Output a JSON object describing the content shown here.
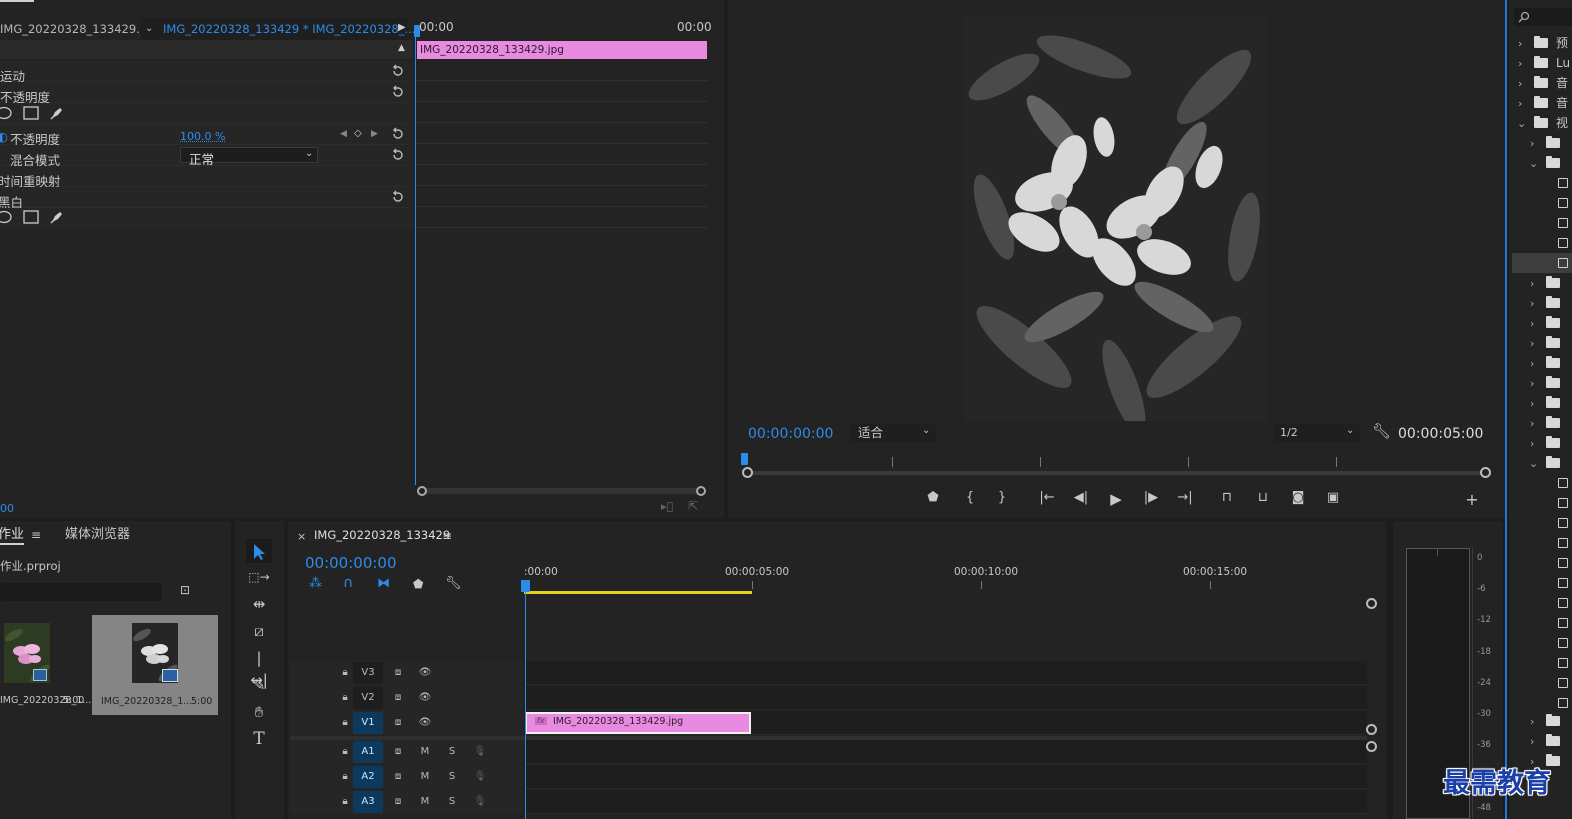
{
  "effect_controls": {
    "master_clip": "IMG_20220328_133429.jpg",
    "sequence_clip": "IMG_20220328_133429 * IMG_20220328_...",
    "time_start": "00:00",
    "time_end": "00:00",
    "clip_bar_label": "IMG_20220328_133429.jpg",
    "rows": {
      "motion": "运动",
      "opacity": "不透明度",
      "opacity_prop": "不透明度",
      "opacity_value": "100.0 %",
      "blend_mode_label": "混合模式",
      "blend_mode_value": "正常",
      "time_remap": "时间重映射",
      "black_white": "黑白"
    },
    "bottom_time": "00"
  },
  "program_monitor": {
    "timecode_left": "00:00:00:00",
    "fit_label": "适合",
    "resolution": "1/2",
    "timecode_right": "00:00:05:00"
  },
  "project": {
    "tab_project": "作业",
    "tab_media_browser": "媒体浏览器",
    "project_file": "作业.prproj",
    "items": [
      {
        "name": "IMG_20220328_1...",
        "duration": "5:00"
      },
      {
        "name": "IMG_20220328_1...",
        "duration": "5:00"
      }
    ]
  },
  "timeline": {
    "close_label": "×",
    "sequence_name": "IMG_20220328_133429",
    "timecode": "00:00:00:00",
    "ruler_labels": [
      ":00:00",
      "00:00:05:00",
      "00:00:10:00",
      "00:00:15:00"
    ],
    "tracks": [
      {
        "label": "V3"
      },
      {
        "label": "V2"
      },
      {
        "label": "V1"
      },
      {
        "label": "A1"
      },
      {
        "label": "A2"
      },
      {
        "label": "A3"
      }
    ],
    "mute_label": "M",
    "solo_label": "S",
    "clip_label": "IMG_20220328_133429.jpg",
    "fx_label": "fx"
  },
  "audio_meter": {
    "scale": [
      "0",
      "-6",
      "-12",
      "-18",
      "-24",
      "-30",
      "-36",
      "-42",
      "-48"
    ]
  },
  "effects_panel": {
    "items": [
      "预",
      "Lu",
      "音",
      "音",
      "视"
    ]
  },
  "watermark": "最需教育",
  "colors": {
    "accent": "#2d8ceb",
    "clip_pink": "#e78ae0",
    "work_area": "#e3d11a",
    "track_on": "#0b3a5e"
  }
}
